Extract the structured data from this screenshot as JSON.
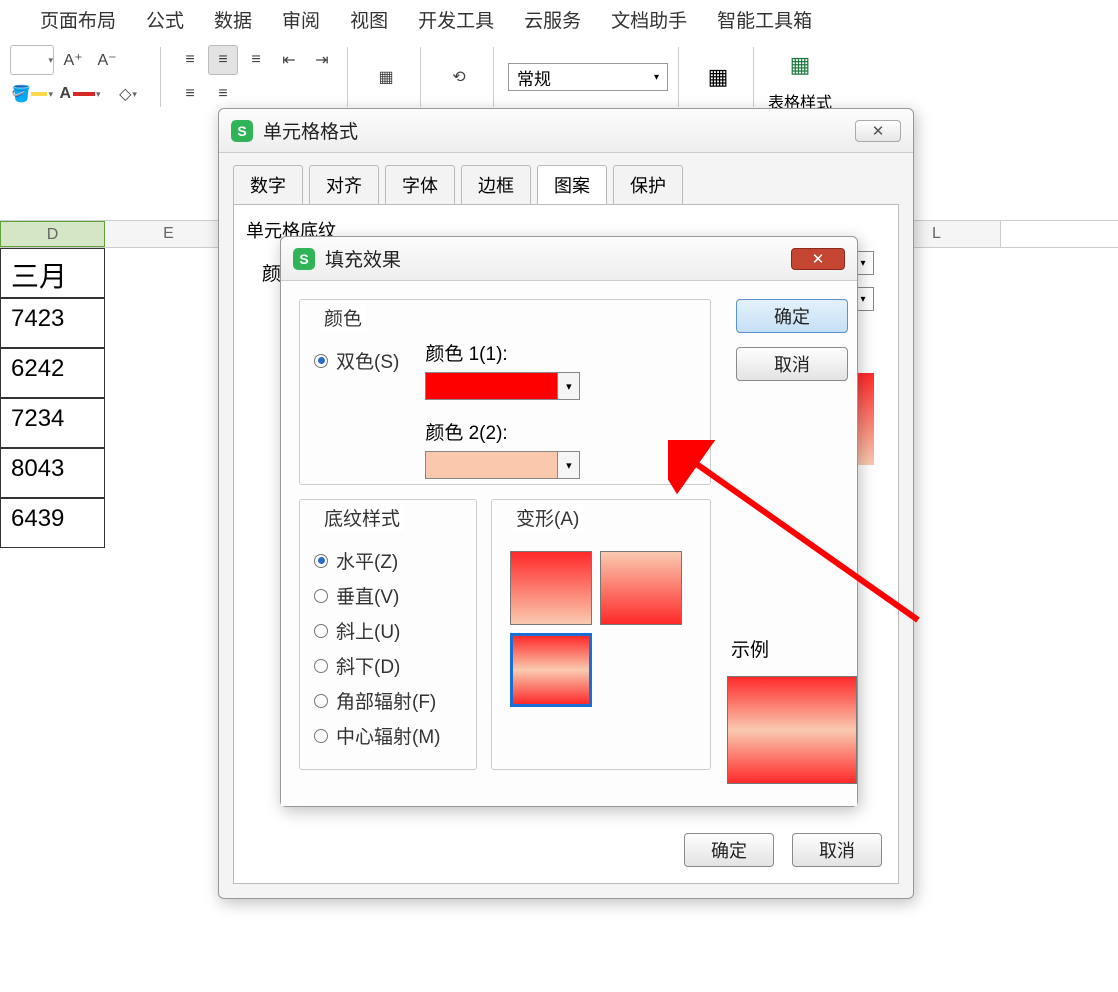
{
  "ribbon": {
    "tabs": [
      "页面布局",
      "公式",
      "数据",
      "审阅",
      "视图",
      "开发工具",
      "云服务",
      "文档助手",
      "智能工具箱"
    ]
  },
  "toolbar": {
    "font_larger": "A⁺",
    "font_smaller": "A⁻",
    "number_format": "常规",
    "table_style": "表格样式"
  },
  "columns": [
    "D",
    "E",
    "",
    "",
    "",
    "",
    "",
    "L"
  ],
  "cells": {
    "header": "三月",
    "rows": [
      "7423",
      "6242",
      "7234",
      "8043",
      "6439"
    ]
  },
  "dlg_format": {
    "title": "单元格格式",
    "tabs": [
      "数字",
      "对齐",
      "字体",
      "边框",
      "图案",
      "保护"
    ],
    "section": "单元格底纹",
    "color_label": "颜",
    "ok": "确定",
    "cancel": "取消"
  },
  "dlg_fill": {
    "title": "填充效果",
    "group_color": "颜色",
    "two_color": "双色(S)",
    "color1_label": "颜色 1(1):",
    "color2_label": "颜色 2(2):",
    "color1": "#ff0000",
    "color2": "#fac9ad",
    "group_style": "底纹样式",
    "variant_label": "变形(A)",
    "sample_label": "示例",
    "styles": [
      "水平(Z)",
      "垂直(V)",
      "斜上(U)",
      "斜下(D)",
      "角部辐射(F)",
      "中心辐射(M)"
    ],
    "ok": "确定",
    "cancel": "取消"
  }
}
